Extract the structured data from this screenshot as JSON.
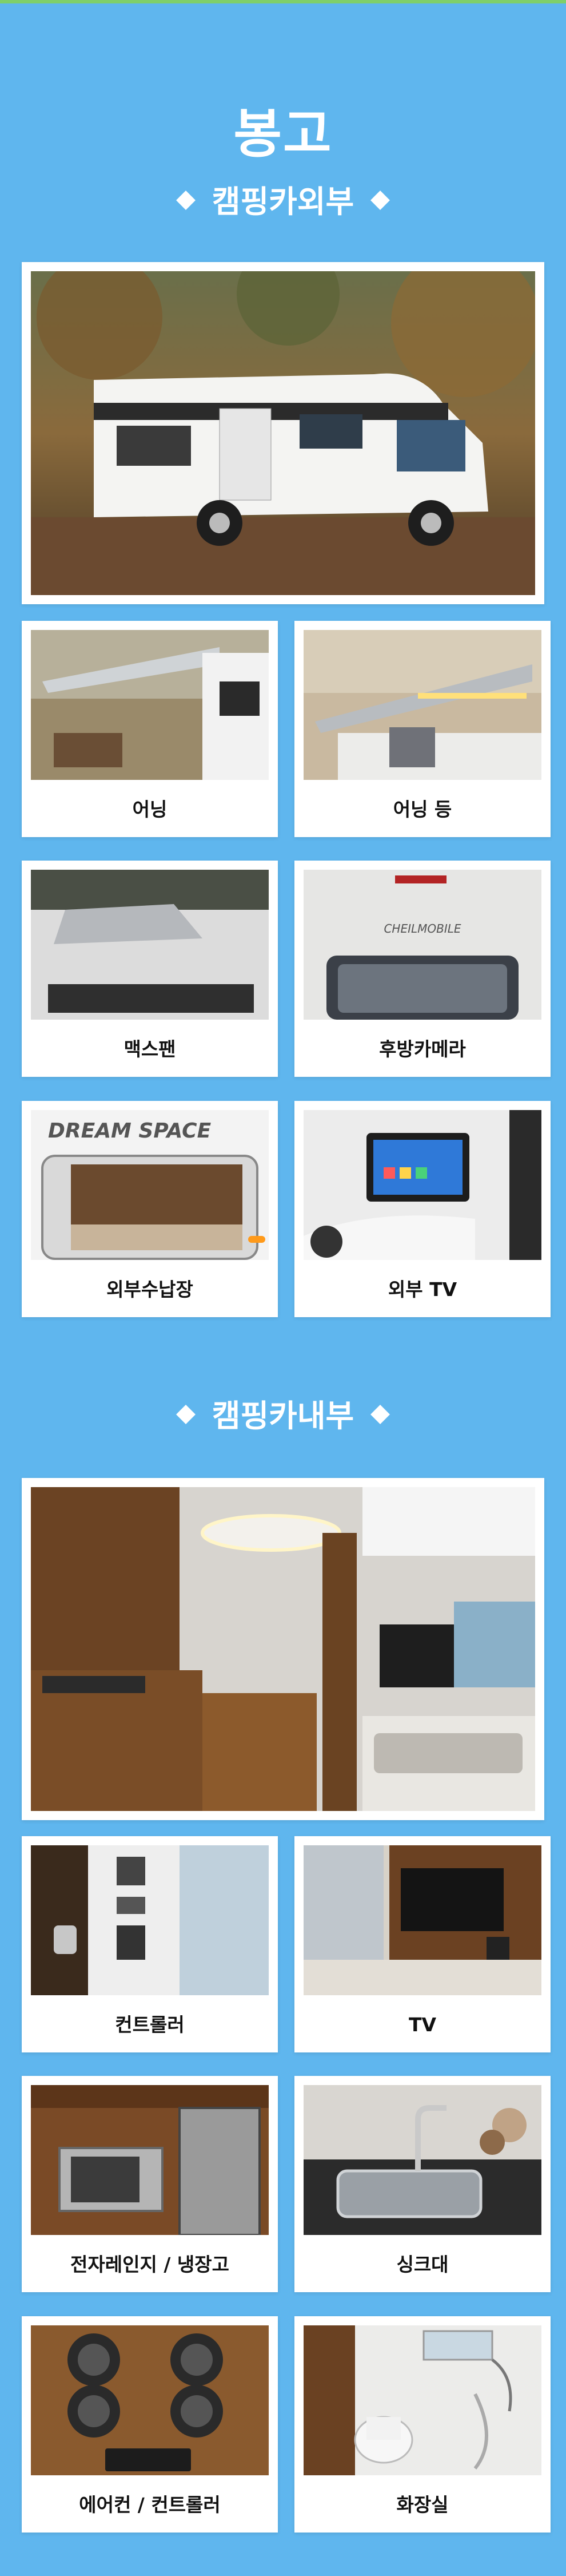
{
  "title": "봉고",
  "sections": {
    "exterior": {
      "heading": "캠핑카외부",
      "items": [
        {
          "label": "어닝"
        },
        {
          "label": "어닝 등"
        },
        {
          "label": "맥스팬"
        },
        {
          "label": "후방카메라"
        },
        {
          "label": "외부수납장"
        },
        {
          "label": "외부 TV"
        }
      ],
      "badge_text": "DREAM SPACE",
      "camera_text": "CHEILMOBILE"
    },
    "interior": {
      "heading": "캠핑카내부",
      "items": [
        {
          "label": "컨트롤러"
        },
        {
          "label": "TV"
        },
        {
          "label": "전자레인지 / 냉장고"
        },
        {
          "label": "싱크대"
        },
        {
          "label": "에어컨 / 컨트롤러"
        },
        {
          "label": "화장실"
        }
      ]
    }
  },
  "colors": {
    "background": "#5fb6ee",
    "card": "#ffffff",
    "heading_text": "#ffffff"
  },
  "icons": [
    "diamond-bullet-icon"
  ]
}
